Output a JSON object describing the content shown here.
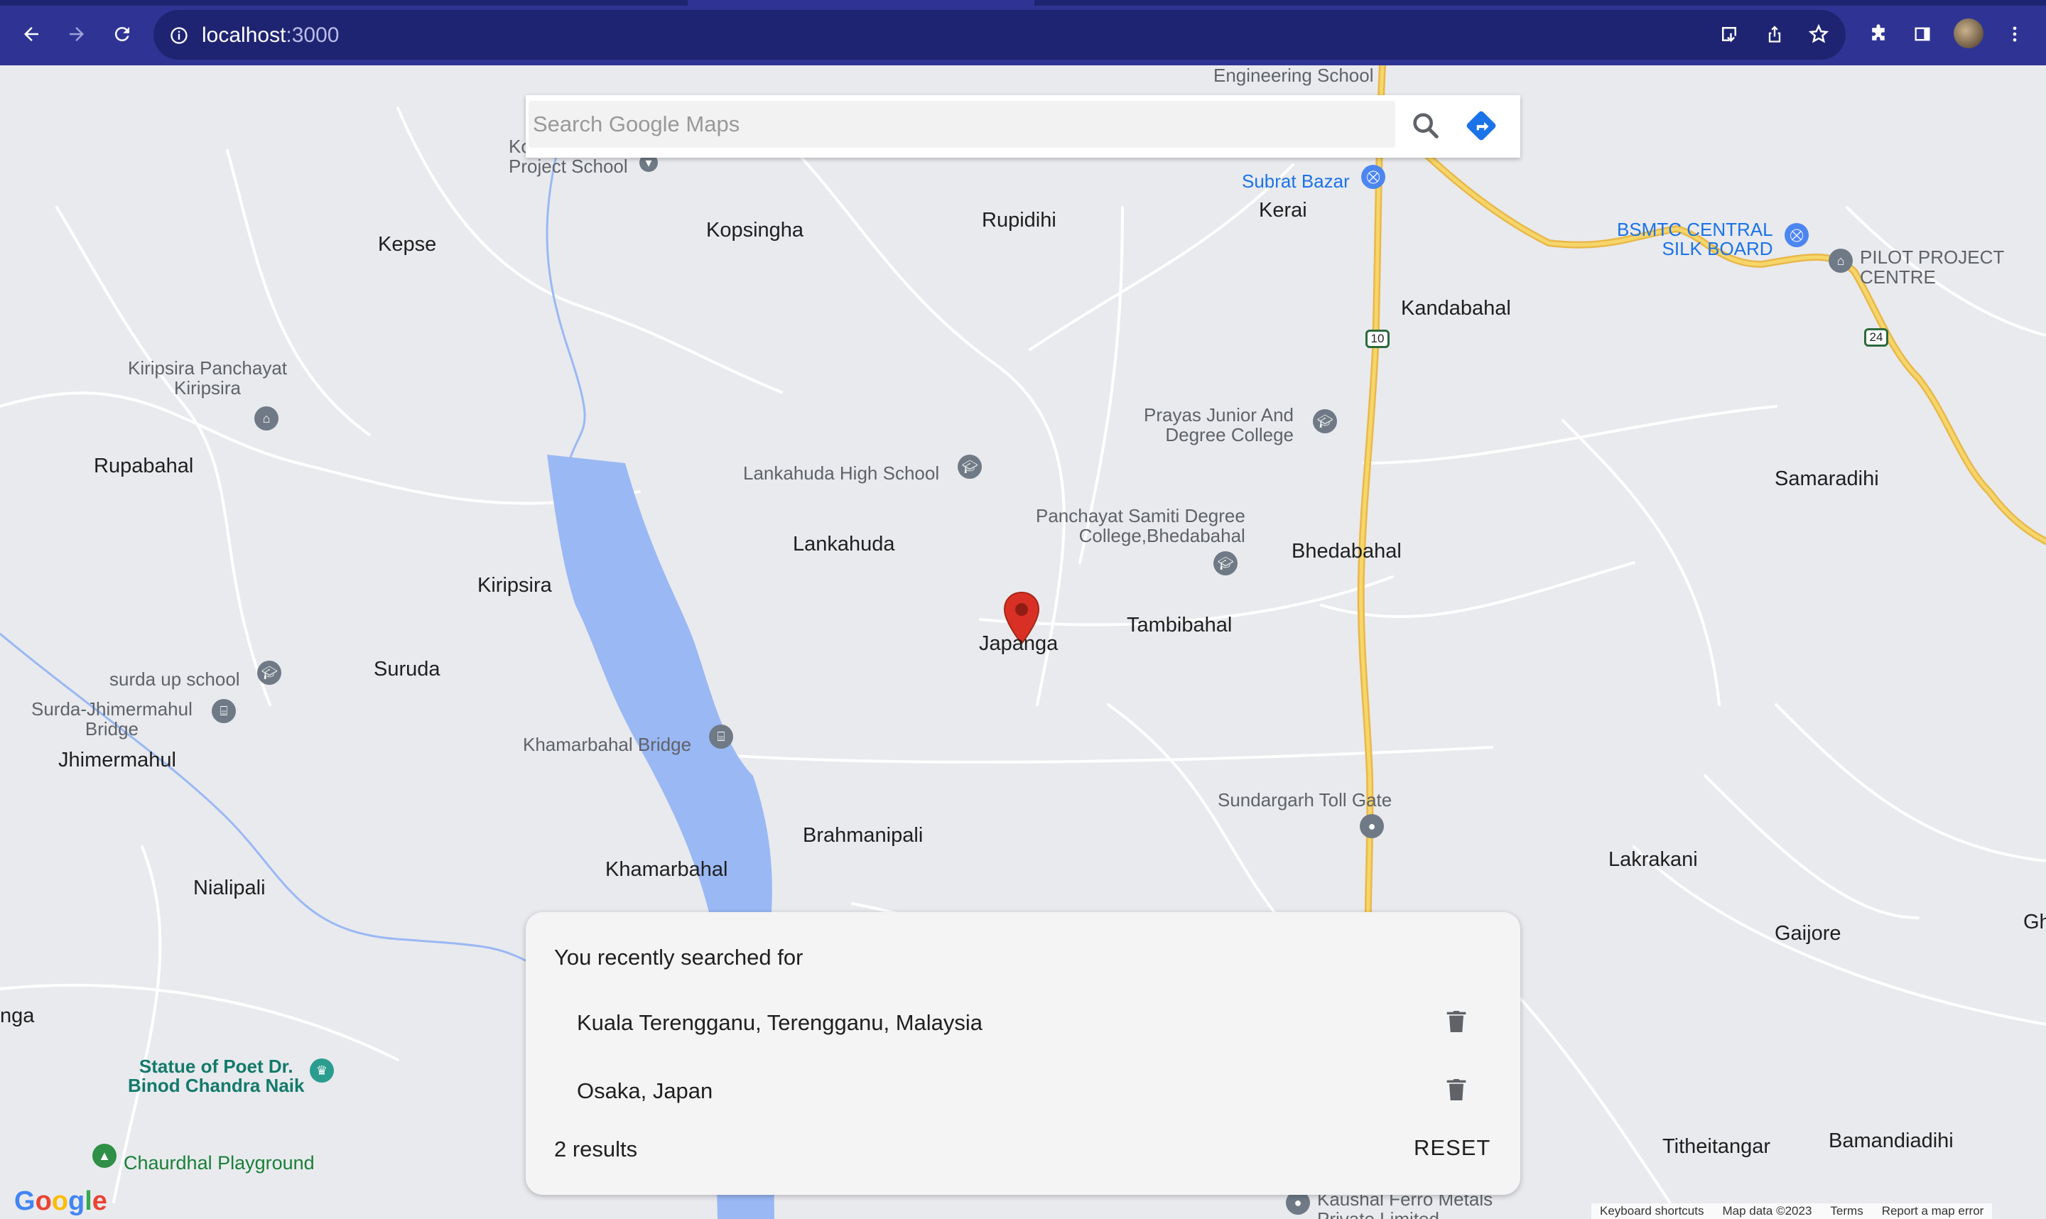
{
  "browser": {
    "url_host": "localhost",
    "url_port": ":3000",
    "icons": [
      "back-arrow-icon",
      "forward-arrow-icon",
      "reload-icon",
      "info-icon",
      "install-icon",
      "share-icon",
      "star-icon",
      "extensions-icon",
      "side-panel-icon",
      "avatar",
      "more-vert-icon"
    ]
  },
  "search": {
    "placeholder": "Search Google Maps",
    "value": ""
  },
  "map": {
    "selected_place": "Japanga",
    "places": {
      "kepse": "Kepse",
      "kopsingha": "Kopsingha",
      "rupidihi": "Rupidihi",
      "kerai": "Kerai",
      "kandabahal": "Kandabahal",
      "rupabahal": "Rupabahal",
      "lankahuda": "Lankahuda",
      "kiripsira": "Kiripsira",
      "suruda": "Suruda",
      "jhimermahul": "Jhimermahul",
      "tambibahal": "Tambibahal",
      "bhedabahal": "Bhedabahal",
      "samaradihi": "Samaradihi",
      "brahmanipali": "Brahmanipali",
      "khamarbahal": "Khamarbahal",
      "nialipali": "Nialipali",
      "lakrakani": "Lakrakani",
      "gaijore": "Gaijore",
      "titheitangar": "Titheitangar",
      "bamandiadihi": "Bamandiadihi",
      "nga": "nga",
      "gh": "Gh"
    },
    "pois": {
      "project_school_1": "Ko",
      "project_school_2": "Project School",
      "subrat_bazar": "Subrat Bazar",
      "bsmtc_1": "BSMTC CENTRAL",
      "bsmtc_2": "SILK BOARD",
      "pilot_1": "PILOT PROJECT",
      "pilot_2": "CENTRE",
      "kiripsira_panchayat_1": "Kiripsira Panchayat",
      "kiripsira_panchayat_2": "Kiripsira",
      "prayas_1": "Prayas Junior And",
      "prayas_2": "Degree College",
      "lankahuda_school": "Lankahuda High School",
      "panchayat_samiti_1": "Panchayat Samiti Degree",
      "panchayat_samiti_2": "College,Bhedabahal",
      "surda_school": "surda up school",
      "surda_bridge_1": "Surda-Jhimermahul",
      "surda_bridge_2": "Bridge",
      "khamarbahal_bridge": "Khamarbahal Bridge",
      "toll_gate": "Sundargarh Toll Gate",
      "statue_1": "Statue of Poet Dr.",
      "statue_2": "Binod Chandra Naik",
      "playground": "Chaurdhal Playground",
      "kaushal_1": "Kaushal Ferro Metals",
      "kaushal_2": "Private Limited",
      "engineering_school": "Engineering School"
    },
    "highways": {
      "nh10": "10",
      "nh24": "24"
    },
    "colors": {
      "road_yellow": "#f6c94a",
      "water": "#9ab8f4",
      "marker_red": "#d93025"
    },
    "footer": {
      "logo": "Google",
      "shortcuts": "Keyboard shortcuts",
      "map_data": "Map data ©2023",
      "terms": "Terms",
      "report": "Report a map error"
    }
  },
  "recent": {
    "heading": "You recently searched for",
    "items": [
      {
        "label": "Kuala Terengganu, Terengganu, Malaysia"
      },
      {
        "label": "Osaka, Japan"
      }
    ],
    "count_text": "2 results",
    "reset_label": "RESET"
  }
}
